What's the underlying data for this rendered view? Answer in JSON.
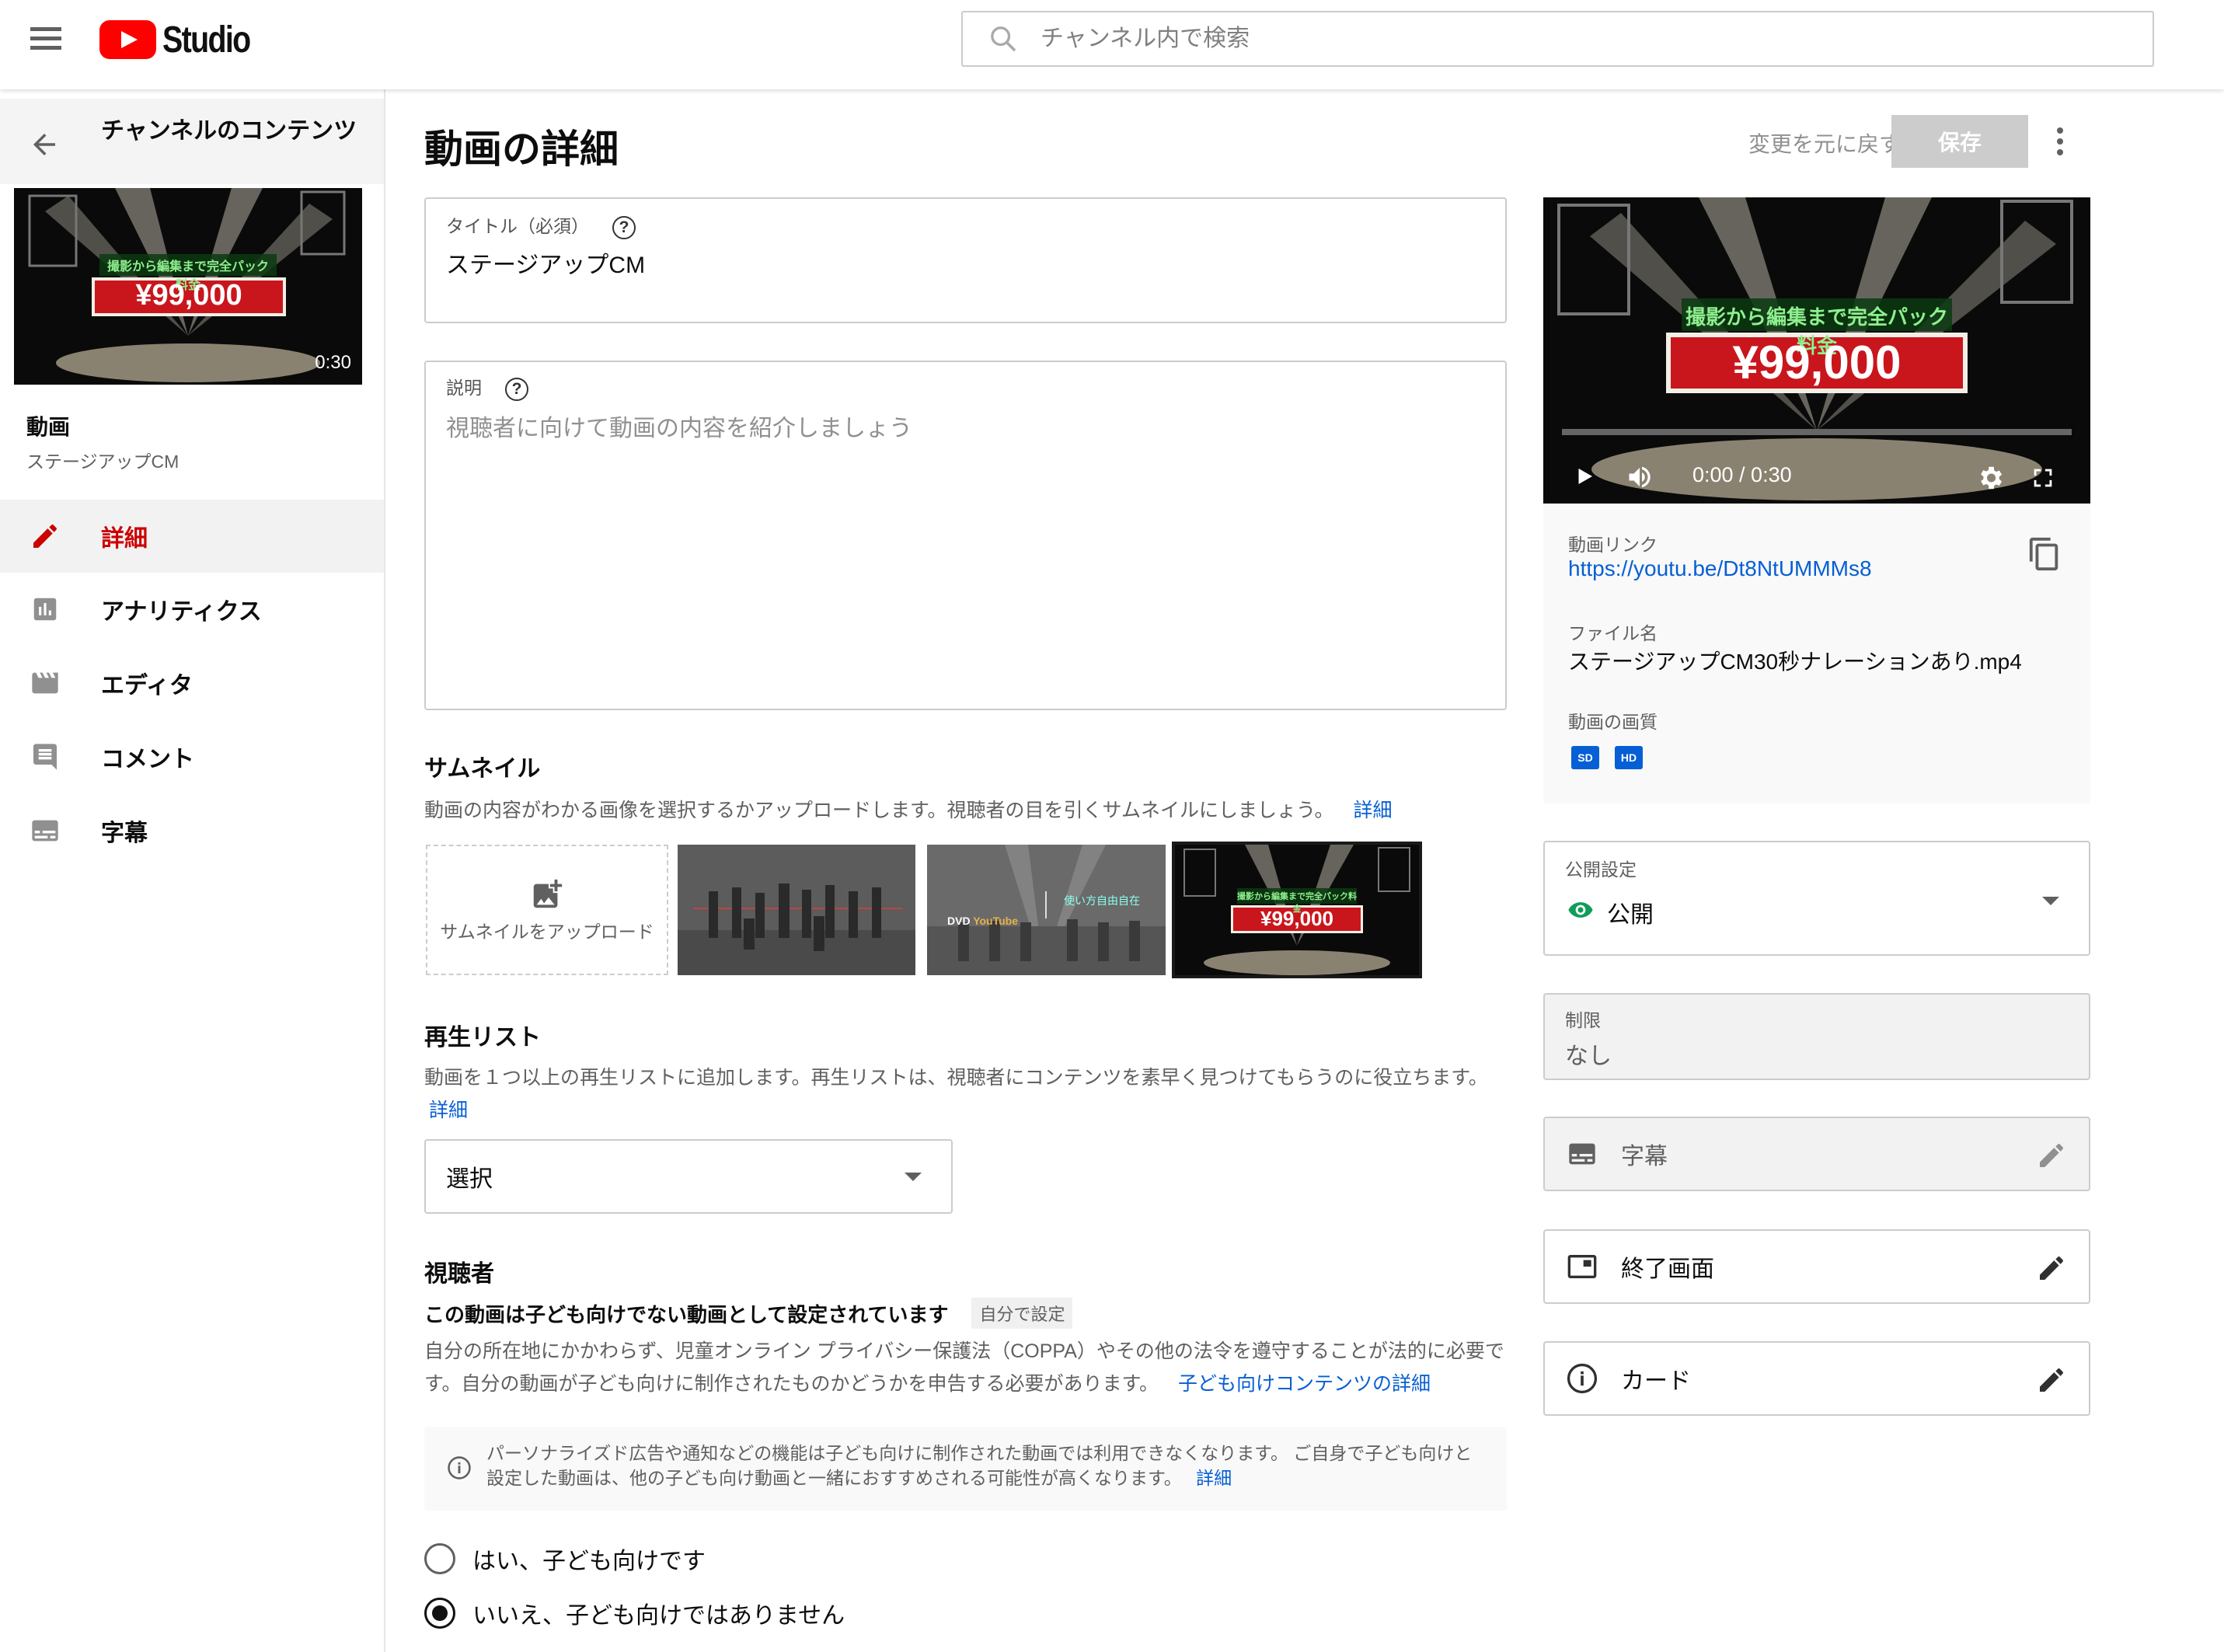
{
  "header": {
    "logo_text": "Studio",
    "search_placeholder": "チャンネル内で検索"
  },
  "sidebar": {
    "back_label": "チャンネルのコンテンツ",
    "thumbnail": {
      "duration": "0:30",
      "headline": "撮影から編集まで完全パック料金",
      "price": "¥99,000"
    },
    "video_label": "動画",
    "video_title": "ステージアップCM",
    "nav": [
      {
        "label": "詳細",
        "icon": "pencil-icon",
        "active": true
      },
      {
        "label": "アナリティクス",
        "icon": "analytics-icon"
      },
      {
        "label": "エディタ",
        "icon": "clapperboard-icon"
      },
      {
        "label": "コメント",
        "icon": "comment-icon"
      },
      {
        "label": "字幕",
        "icon": "subtitles-icon"
      }
    ]
  },
  "main": {
    "page_title": "動画の詳細",
    "undo_label": "変更を元に戻す",
    "save_label": "保存",
    "title_field": {
      "label": "タイトル（必須）",
      "value": "ステージアップCM"
    },
    "description_field": {
      "label": "説明",
      "placeholder": "視聴者に向けて動画の内容を紹介しましょう"
    },
    "thumbnail_section": {
      "heading": "サムネイル",
      "text": "動画の内容がわかる画像を選択するかアップロードします。視聴者の目を引くサムネイルにしましょう。",
      "link": "詳細",
      "upload_label": "サムネイルをアップロード",
      "thumb_texts": {
        "t2_a": "DVD",
        "t2_b": "YouTube",
        "t2_c": "使い方自由自在",
        "t3_headline": "撮影から編集まで完全パック料金",
        "t3_price": "¥99,000"
      }
    },
    "playlist_section": {
      "heading": "再生リスト",
      "text": "動画を１つ以上の再生リストに追加します。再生リストは、視聴者にコンテンツを素早く見つけてもらうのに役立ちます。",
      "link": "詳細",
      "select_value": "選択"
    },
    "audience_section": {
      "heading": "視聴者",
      "status": "この動画は子ども向けでない動画として設定されています",
      "status_chip": "自分で設定",
      "text": "自分の所在地にかかわらず、児童オンライン プライバシー保護法（COPPA）やその他の法令を遵守することが法的に必要です。自分の動画が子ども向けに制作されたものかどうかを申告する必要があります。",
      "link": "子ども向けコンテンツの詳細",
      "info_text": "パーソナライズド広告や通知などの機能は子ども向けに制作された動画では利用できなくなります。 ご自身で子ども向けと設定した動画は、他の子ども向け動画と一緒におすすめされる可能性が高くなります。",
      "info_link": "詳細",
      "option_yes": "はい、子ども向けです",
      "option_no": "いいえ、子ども向けではありません",
      "selected": "no"
    }
  },
  "right": {
    "player": {
      "time": "0:00 / 0:30",
      "headline": "撮影から編集まで完全パック料金",
      "price": "¥99,000",
      "progress": 0
    },
    "video_link_label": "動画リンク",
    "video_link": "https://youtu.be/Dt8NtUMMMs8",
    "filename_label": "ファイル名",
    "filename": "ステージアップCM30秒ナレーションあり.mp4",
    "quality_label": "動画の画質",
    "quality_badges": [
      "SD",
      "HD"
    ],
    "visibility_label": "公開設定",
    "visibility_value": "公開",
    "restriction_label": "制限",
    "restriction_value": "なし",
    "subtitles_label": "字幕",
    "endscreen_label": "終了画面",
    "cards_label": "カード"
  },
  "colors": {
    "accent_red": "#cc0000",
    "link_blue": "#065fd4",
    "public_green": "#0f9d58",
    "youtube_red": "#ff0000"
  }
}
